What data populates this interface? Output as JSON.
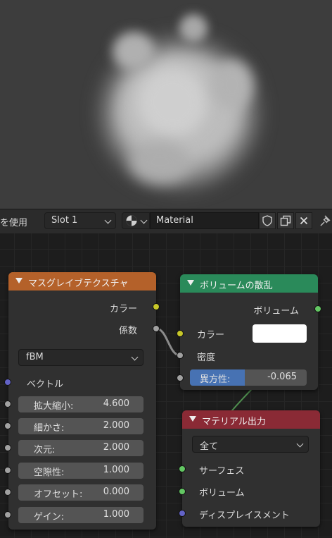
{
  "header": {
    "left_label": "を使用",
    "slot": "Slot 1",
    "material_name": "Material"
  },
  "nodes": {
    "musgrave": {
      "title": "マスグレイブテクスチャ",
      "outputs": [
        "カラー",
        "係数"
      ],
      "type_value": "fBM",
      "vector_label": "ベクトル",
      "fields": [
        {
          "label": "拡大縮小:",
          "value": "4.600"
        },
        {
          "label": "細かさ:",
          "value": "2.000"
        },
        {
          "label": "次元:",
          "value": "2.000"
        },
        {
          "label": "空隙性:",
          "value": "1.000"
        },
        {
          "label": "オフセット:",
          "value": "0.000"
        },
        {
          "label": "ゲイン:",
          "value": "1.000"
        }
      ]
    },
    "volume_scatter": {
      "title": "ボリュームの散乱",
      "output": "ボリューム",
      "color_label": "カラー",
      "density_label": "密度",
      "anisotropy_label": "異方性:",
      "anisotropy_value": "-0.065",
      "anisotropy": -0.065
    },
    "material_output": {
      "title": "マテリアル出力",
      "target": "全て",
      "inputs": [
        "サーフェス",
        "ボリューム",
        "ディスプレイスメント"
      ]
    }
  },
  "colors": {
    "texture_header": "#b4612a",
    "shader_header": "#2a8a5a",
    "output_header": "#8a2a35",
    "socket_color": "#c7c729",
    "socket_float": "#a1a1a1",
    "socket_vector": "#6363c7",
    "socket_shader": "#63c763"
  }
}
